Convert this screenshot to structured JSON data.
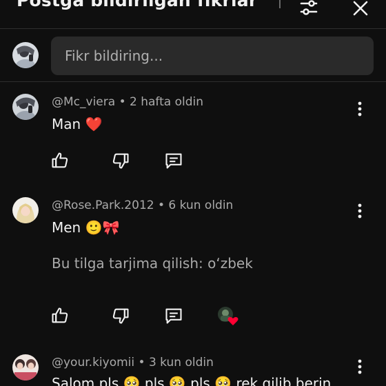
{
  "header": {
    "title": "Postga bildirilgan fikrlar"
  },
  "composer": {
    "placeholder": "Fikr bildiring..."
  },
  "comments": [
    {
      "author": "@Mc_viera",
      "time": "2 hafta oldin",
      "text": "Man",
      "emoji": "❤️"
    },
    {
      "author": "@Rose.Park.2012",
      "time": "6 kun oldin",
      "text": "Men",
      "emoji": "🙂🎀",
      "translate": "Bu tilga tarjima qilish: o‘zbek"
    },
    {
      "author": "@your.kiyomii",
      "time": "3 kun oldin",
      "text": "Salom pls 🥺 pls 🥺 pls 🥺 rek qilib berin"
    }
  ],
  "colors": {
    "background": "#0f0f0f",
    "input_bg": "#2a2a2a",
    "heart": "#ff0033"
  }
}
